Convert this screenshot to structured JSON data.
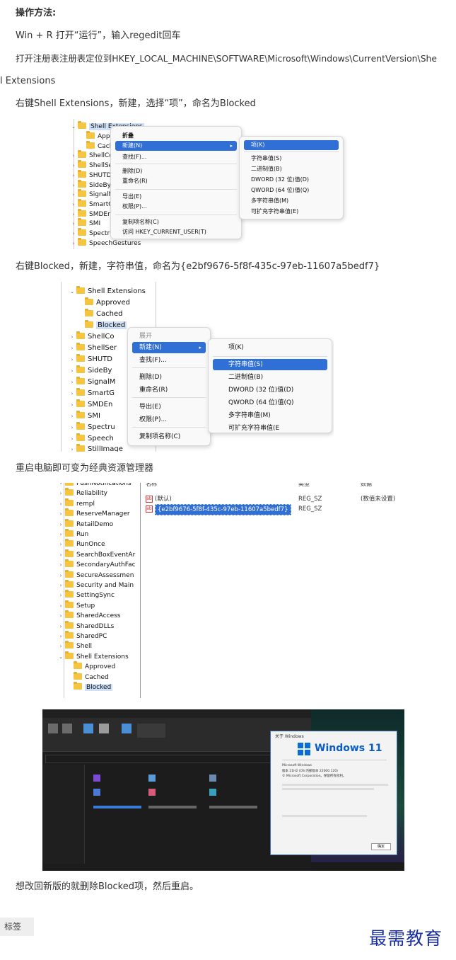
{
  "article": {
    "heading": "操作方法:",
    "step1": "Win + R 打开“运行”，输入regedit回车",
    "step2a": "打开注册表注册表定位到HKEY_LOCAL_MACHINE\\SOFTWARE\\Microsoft\\Windows\\CurrentVersion\\She",
    "step2b": "l Extensions",
    "step3": "右键Shell Extensions，新建，选择“项”，命名为Blocked",
    "step4": "右键Blocked，新建，字符串值，命名为{e2bf9676-5f8f-435c-97eb-11607a5bedf7}",
    "step5": "重启电脑即可变为经典资源管理器",
    "step6": "想改回新版的就删除Blocked项，然后重启。"
  },
  "shot1": {
    "tree": [
      "Shell Extensions",
      "Appro",
      "Cache",
      "ShellCom",
      "ShellServ",
      "SHUTDO",
      "SideBySi",
      "SignalMa",
      "SmartGla",
      "SMDEn",
      "SMI",
      "Spectrum",
      "SpeechGestures"
    ],
    "menu": [
      "折叠",
      "新建(N)",
      "查找(F)...",
      "删除(D)",
      "重命名(R)",
      "导出(E)",
      "权限(P)...",
      "复制项名称(C)",
      "访问 HKEY_CURRENT_USER(T)"
    ],
    "submenu": [
      "项(K)",
      "字符串值(S)",
      "二进制值(B)",
      "DWORD (32 位)值(D)",
      "QWORD (64 位)值(Q)",
      "多字符串值(M)",
      "可扩充字符串值(E)"
    ]
  },
  "shot2": {
    "tree": [
      "Shell Extensions",
      "Approved",
      "Cached",
      "Blocked",
      "ShellCo",
      "ShellSer",
      "SHUTD",
      "SideBy",
      "SignalM",
      "SmartG",
      "SMDEn",
      "SMI",
      "Spectru",
      "Speech",
      "StillImage"
    ],
    "menu": [
      "展开",
      "新建(N)",
      "查找(F)...",
      "删除(D)",
      "重命名(R)",
      "导出(E)",
      "权限(P)...",
      "复制项名称(C)"
    ],
    "submenu": [
      "项(K)",
      "字符串值(S)",
      "二进制值(B)",
      "DWORD (32 位)值(D)",
      "QWORD (64 位)值(Q)",
      "多字符串值(M)",
      "可扩充字符串值(E"
    ]
  },
  "shot3": {
    "tree": [
      "PushNotifications",
      "Reliability",
      "rempl",
      "ReserveManager",
      "RetailDemo",
      "Run",
      "RunOnce",
      "SearchBoxEventAr",
      "SecondaryAuthFac",
      "SecureAssessmen",
      "Security and Main",
      "SettingSync",
      "Setup",
      "SharedAccess",
      "SharedDLLs",
      "SharedPC",
      "Shell",
      "Shell Extensions",
      "Approved",
      "Cached",
      "Blocked"
    ],
    "col_headers": [
      "名称",
      "类型",
      "数据"
    ],
    "rows": [
      {
        "name": "(默认)",
        "type": "REG_SZ",
        "data": "(数值未设置)"
      },
      {
        "name": "{e2bf9676-5f8f-435c-97eb-11607a5bedf7}",
        "type": "REG_SZ",
        "data": ""
      }
    ]
  },
  "shot4": {
    "about_title": "关于 Windows",
    "logo_text": "Windows 11",
    "lines": [
      "Microsoft Windows",
      "版本 21H2 (OS 内部版本 22000.120)",
      "© Microsoft Corporation。保留所有权利。"
    ],
    "ok": "确定"
  },
  "footer": {
    "tag": "标签",
    "brand": "最需教育"
  },
  "colors": {
    "accent": "#2f6fd6",
    "brand": "#1a2fa0"
  }
}
